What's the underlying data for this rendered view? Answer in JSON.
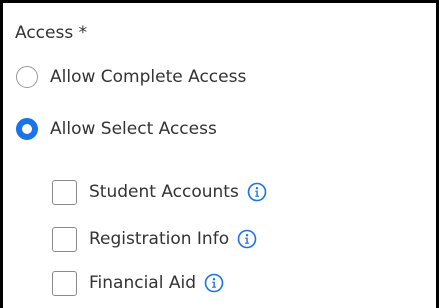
{
  "field": {
    "label": "Access *"
  },
  "radios": [
    {
      "label": "Allow Complete Access",
      "selected": false
    },
    {
      "label": "Allow Select Access",
      "selected": true
    }
  ],
  "checkboxes": [
    {
      "label": "Student Accounts",
      "checked": false
    },
    {
      "label": "Registration Info",
      "checked": false
    },
    {
      "label": "Financial Aid",
      "checked": false
    }
  ],
  "colors": {
    "accent": "#1a73e8"
  },
  "icons": {
    "info": "info-icon"
  }
}
